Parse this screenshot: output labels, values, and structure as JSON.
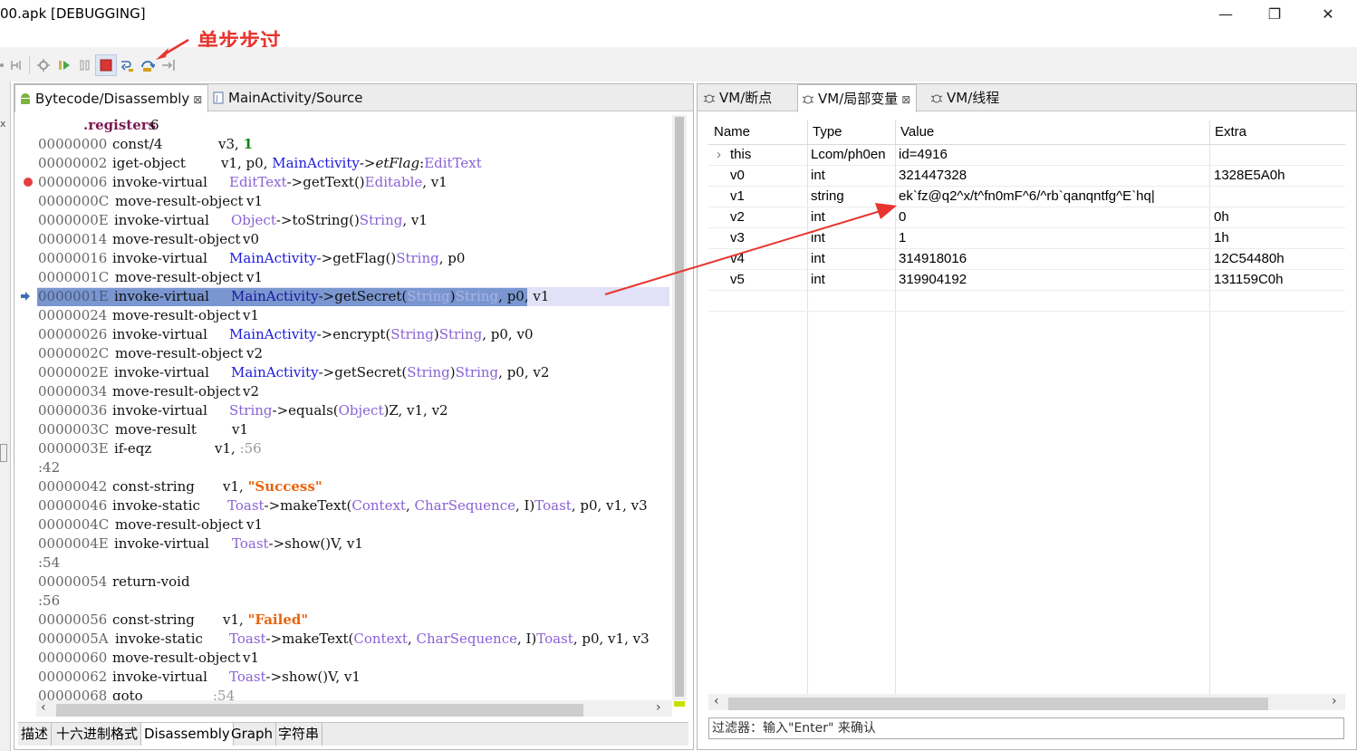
{
  "window": {
    "title": "00.apk [DEBUGGING]",
    "minimize": "—",
    "maximize": "❐",
    "close": "✕"
  },
  "annotation": {
    "label": "单步步过",
    "color": "#e8352f"
  },
  "toolbar": {
    "icons": [
      "collapse-icon",
      "attach-icon",
      "resume-icon",
      "pause-icon",
      "terminate-icon",
      "step-into-icon",
      "step-over-icon",
      "step-return-icon"
    ]
  },
  "left_panel": {
    "tabs": [
      {
        "label": "Bytecode/Disassembly",
        "close": "⊠",
        "icon": "android-icon"
      },
      {
        "label": "MainActivity/Source",
        "icon": "java-file-icon"
      }
    ],
    "code_lines": [
      {
        "addr": "",
        "op": ".registers",
        "args": "6"
      },
      {
        "addr": "00000000",
        "op": "const/4",
        "args": "v3, 1"
      },
      {
        "addr": "00000002",
        "op": "iget-object",
        "args": "v1, p0, MainActivity->etFlag:EditText"
      },
      {
        "addr": "00000006",
        "op": "invoke-virtual",
        "args": "EditText->getText()Editable, v1"
      },
      {
        "addr": "0000000C",
        "op": "move-result-object",
        "args": "v1"
      },
      {
        "addr": "0000000E",
        "op": "invoke-virtual",
        "args": "Object->toString()String, v1"
      },
      {
        "addr": "00000014",
        "op": "move-result-object",
        "args": "v0"
      },
      {
        "addr": "00000016",
        "op": "invoke-virtual",
        "args": "MainActivity->getFlag()String, p0"
      },
      {
        "addr": "0000001C",
        "op": "move-result-object",
        "args": "v1"
      },
      {
        "addr": "0000001E",
        "op": "invoke-virtual",
        "args": "MainActivity->getSecret(String)String, p0, v1"
      },
      {
        "addr": "00000024",
        "op": "move-result-object",
        "args": "v1"
      },
      {
        "addr": "00000026",
        "op": "invoke-virtual",
        "args": "MainActivity->encrypt(String)String, p0, v0"
      },
      {
        "addr": "0000002C",
        "op": "move-result-object",
        "args": "v2"
      },
      {
        "addr": "0000002E",
        "op": "invoke-virtual",
        "args": "MainActivity->getSecret(String)String, p0, v2"
      },
      {
        "addr": "00000034",
        "op": "move-result-object",
        "args": "v2"
      },
      {
        "addr": "00000036",
        "op": "invoke-virtual",
        "args": "String->equals(Object)Z, v1, v2"
      },
      {
        "addr": "0000003C",
        "op": "move-result",
        "args": "v1"
      },
      {
        "addr": "0000003E",
        "op": "if-eqz",
        "args": "v1, :56"
      },
      {
        "label": ":42"
      },
      {
        "addr": "00000042",
        "op": "const-string",
        "args": "v1, \"Success\""
      },
      {
        "addr": "00000046",
        "op": "invoke-static",
        "args": "Toast->makeText(Context, CharSequence, I)Toast, p0, v1, v3"
      },
      {
        "addr": "0000004C",
        "op": "move-result-object",
        "args": "v1"
      },
      {
        "addr": "0000004E",
        "op": "invoke-virtual",
        "args": "Toast->show()V, v1"
      },
      {
        "label": ":54"
      },
      {
        "addr": "00000054",
        "op": "return-void",
        "args": ""
      },
      {
        "label": ":56"
      },
      {
        "addr": "00000056",
        "op": "const-string",
        "args": "v1, \"Failed\""
      },
      {
        "addr": "0000005A",
        "op": "invoke-static",
        "args": "Toast->makeText(Context, CharSequence, I)Toast, p0, v1, v3"
      },
      {
        "addr": "00000060",
        "op": "move-result-object",
        "args": "v1"
      },
      {
        "addr": "00000062",
        "op": "invoke-virtual",
        "args": "Toast->show()V, v1"
      },
      {
        "addr": "00000068",
        "op": "goto",
        "args": ":54"
      }
    ],
    "breakpoint_line": "00000006",
    "current_line": "0000001E",
    "bottom_tabs": [
      "描述",
      "十六进制格式",
      "Disassembly",
      "Graph",
      "字符串"
    ],
    "active_bottom_tab": "Disassembly"
  },
  "right_panel": {
    "tabs": [
      {
        "label": "VM/断点",
        "icon": "bug-icon"
      },
      {
        "label": "VM/局部变量",
        "close": "⊠",
        "icon": "bug-icon"
      },
      {
        "label": "VM/线程",
        "icon": "bug-icon"
      }
    ],
    "columns": [
      "Name",
      "Type",
      "Value",
      "Extra"
    ],
    "rows": [
      {
        "name": "this",
        "type": "Lcom/ph0en",
        "value": "id=4916",
        "extra": "",
        "expander": "›"
      },
      {
        "name": "v0",
        "type": "int",
        "value": "321447328",
        "extra": "1328E5A0h"
      },
      {
        "name": "v1",
        "type": "string",
        "value": "ek`fz@q2^x/t^fn0mF^6/^rb`qanqntfg^E`hq|",
        "extra": ""
      },
      {
        "name": "v2",
        "type": "int",
        "value": "0",
        "extra": "0h"
      },
      {
        "name": "v3",
        "type": "int",
        "value": "1",
        "extra": "1h"
      },
      {
        "name": "v4",
        "type": "int",
        "value": "314918016",
        "extra": "12C54480h"
      },
      {
        "name": "v5",
        "type": "int",
        "value": "319904192",
        "extra": "131159C0h"
      }
    ],
    "filter_placeholder": "过滤器：输入\"Enter\" 来确认"
  }
}
